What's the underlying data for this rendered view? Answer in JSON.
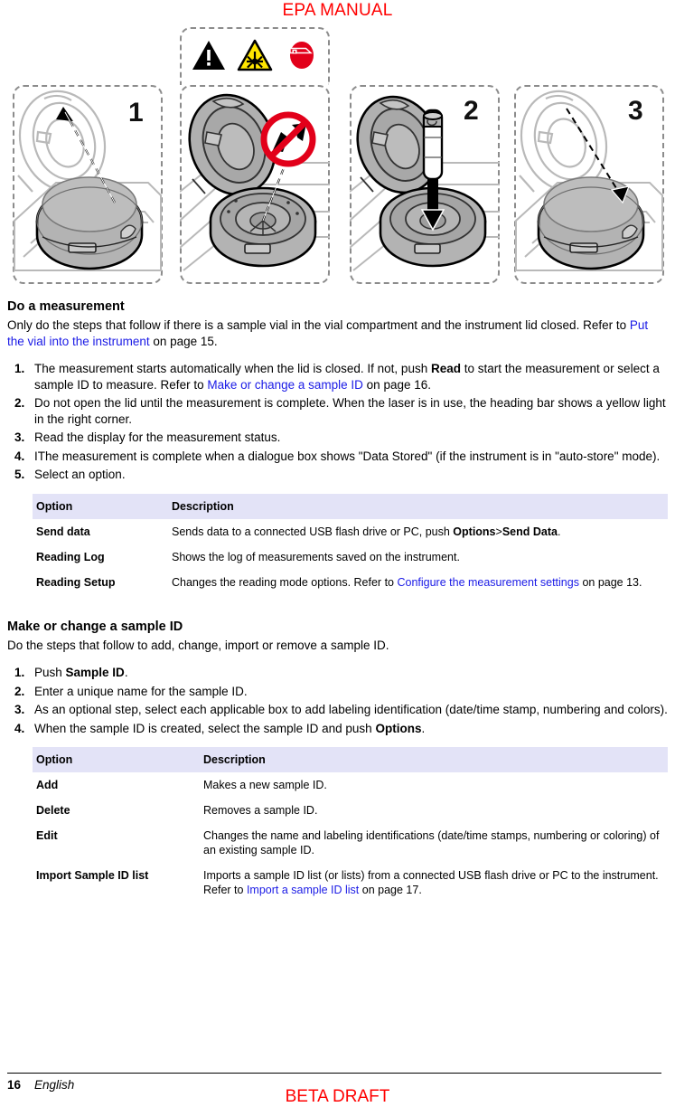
{
  "header": {
    "watermark": "EPA MANUAL"
  },
  "illustration": {
    "alt": "Instrument lid open/close and vial insertion sequence",
    "steps": [
      "1",
      "2",
      "3"
    ],
    "warning_icons": [
      {
        "name": "general-warning-icon",
        "label": "General warning"
      },
      {
        "name": "laser-warning-icon",
        "label": "Laser radiation warning"
      },
      {
        "name": "face-shield-icon",
        "label": "Wear face shield"
      }
    ],
    "prohibition": {
      "name": "no-look-into-beam-icon",
      "label": "Do not look into the beam"
    }
  },
  "sections": [
    {
      "id": "do-a-measurement",
      "title": "Do a measurement",
      "intro_pre": "Only do the steps that follow if there is a sample vial in the vial compartment and the instrument lid closed. Refer to ",
      "intro_link": "Put the vial into the instrument",
      "intro_post": " on page 15.",
      "steps": [
        {
          "parts": [
            {
              "t": "The measurement starts automatically when the lid is closed. If not, push ",
              "s": "plain"
            },
            {
              "t": "Read",
              "s": "bold"
            },
            {
              "t": " to start the measurement or select a sample ID to measure. Refer to ",
              "s": "plain"
            },
            {
              "t": "Make or change a sample ID",
              "s": "link"
            },
            {
              "t": " on page 16.",
              "s": "plain"
            }
          ]
        },
        {
          "parts": [
            {
              "t": "Do not open the lid until the measurement is complete. When the laser is in use, the heading bar shows a yellow light in the right corner.",
              "s": "plain"
            }
          ]
        },
        {
          "parts": [
            {
              "t": "Read the display for the measurement status.",
              "s": "plain"
            }
          ]
        },
        {
          "parts": [
            {
              "t": "IThe measurement is complete when a dialogue box shows \"Data Stored\" (if the instrument is in \"auto-store\" mode).",
              "s": "plain"
            }
          ]
        },
        {
          "parts": [
            {
              "t": "Select an option.",
              "s": "plain"
            }
          ]
        }
      ],
      "table": {
        "headers": [
          "Option",
          "Description"
        ],
        "rows": [
          {
            "option": "Send data",
            "desc_parts": [
              {
                "t": "Sends data to a connected USB flash drive or PC, push ",
                "s": "plain"
              },
              {
                "t": "Options",
                "s": "bold"
              },
              {
                "t": ">",
                "s": "plain"
              },
              {
                "t": "Send Data",
                "s": "bold"
              },
              {
                "t": ".",
                "s": "plain"
              }
            ]
          },
          {
            "option": "Reading Log",
            "desc_parts": [
              {
                "t": "Shows the log of measurements saved on the instrument.",
                "s": "plain"
              }
            ]
          },
          {
            "option": "Reading Setup",
            "desc_parts": [
              {
                "t": "Changes the reading mode options. Refer to ",
                "s": "plain"
              },
              {
                "t": "Configure the measurement settings",
                "s": "link"
              },
              {
                "t": " on page 13.",
                "s": "plain"
              }
            ]
          }
        ]
      }
    },
    {
      "id": "make-or-change-a-sample-id",
      "title": "Make or change a sample ID",
      "intro_pre": "Do the steps that follow to add, change, import or remove a sample ID.",
      "intro_link": "",
      "intro_post": "",
      "steps": [
        {
          "parts": [
            {
              "t": "Push ",
              "s": "plain"
            },
            {
              "t": "Sample ID",
              "s": "bold"
            },
            {
              "t": ".",
              "s": "plain"
            }
          ]
        },
        {
          "parts": [
            {
              "t": "Enter a unique name for the sample ID.",
              "s": "plain"
            }
          ]
        },
        {
          "parts": [
            {
              "t": "As an optional step, select each applicable box to add labeling identification (date/time stamp, numbering and colors).",
              "s": "plain"
            }
          ]
        },
        {
          "parts": [
            {
              "t": "When the sample ID is created, select the sample ID and push ",
              "s": "plain"
            },
            {
              "t": "Options",
              "s": "bold"
            },
            {
              "t": ".",
              "s": "plain"
            }
          ]
        }
      ],
      "table": {
        "headers": [
          "Option",
          "Description"
        ],
        "rows": [
          {
            "option": "Add",
            "desc_parts": [
              {
                "t": "Makes a new sample ID.",
                "s": "plain"
              }
            ]
          },
          {
            "option": "Delete",
            "desc_parts": [
              {
                "t": "Removes a sample ID.",
                "s": "plain"
              }
            ]
          },
          {
            "option": "Edit",
            "desc_parts": [
              {
                "t": "Changes the name and labeling identifications (date/time stamps, numbering or coloring) of an existing sample ID.",
                "s": "plain"
              }
            ]
          },
          {
            "option": "Import Sample ID list",
            "desc_parts": [
              {
                "t": "Imports a sample ID list (or lists) from a connected USB flash drive or PC to the instrument. Refer to ",
                "s": "plain"
              },
              {
                "t": "Import a sample ID list",
                "s": "link"
              },
              {
                "t": " on page 17.",
                "s": "plain"
              }
            ]
          }
        ]
      }
    }
  ],
  "footer": {
    "page_number": "16",
    "language": "English",
    "draft_mark": "BETA DRAFT"
  },
  "colors": {
    "link": "#1a1ae6",
    "watermark": "#ff0000",
    "table_header_bg": "#e3e3f7",
    "warning_yellow": "#ffe600",
    "prohibition_red": "#e2001a"
  }
}
